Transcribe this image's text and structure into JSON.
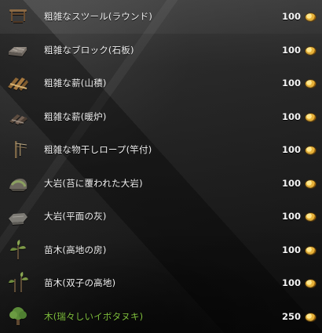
{
  "items": [
    {
      "label": "粗雑なスツール(ラウンド)",
      "price": "100",
      "icon": "stool-icon"
    },
    {
      "label": "粗雑なブロック(石板)",
      "price": "100",
      "icon": "stone-slab-icon"
    },
    {
      "label": "粗雑な薪(山積)",
      "price": "100",
      "icon": "firewood-pile-icon"
    },
    {
      "label": "粗雑な薪(暖炉)",
      "price": "100",
      "icon": "fireplace-firewood-icon"
    },
    {
      "label": "粗雑な物干しロープ(竿付)",
      "price": "100",
      "icon": "clothesline-pole-icon"
    },
    {
      "label": "大岩(苔に覆われた大岩)",
      "price": "100",
      "icon": "mossy-rock-icon"
    },
    {
      "label": "大岩(平面の灰)",
      "price": "100",
      "icon": "flat-gray-rock-icon"
    },
    {
      "label": "苗木(高地の房)",
      "price": "100",
      "icon": "seedling-highland-icon"
    },
    {
      "label": "苗木(双子の高地)",
      "price": "100",
      "icon": "seedling-twin-icon"
    },
    {
      "label": "木(瑞々しいイボタヌキ)",
      "price": "250",
      "icon": "tree-icon"
    }
  ],
  "colors": {
    "text": "#f1f1f1",
    "highlight_text": "#7fbe3d",
    "coin": "#e8b33b"
  }
}
